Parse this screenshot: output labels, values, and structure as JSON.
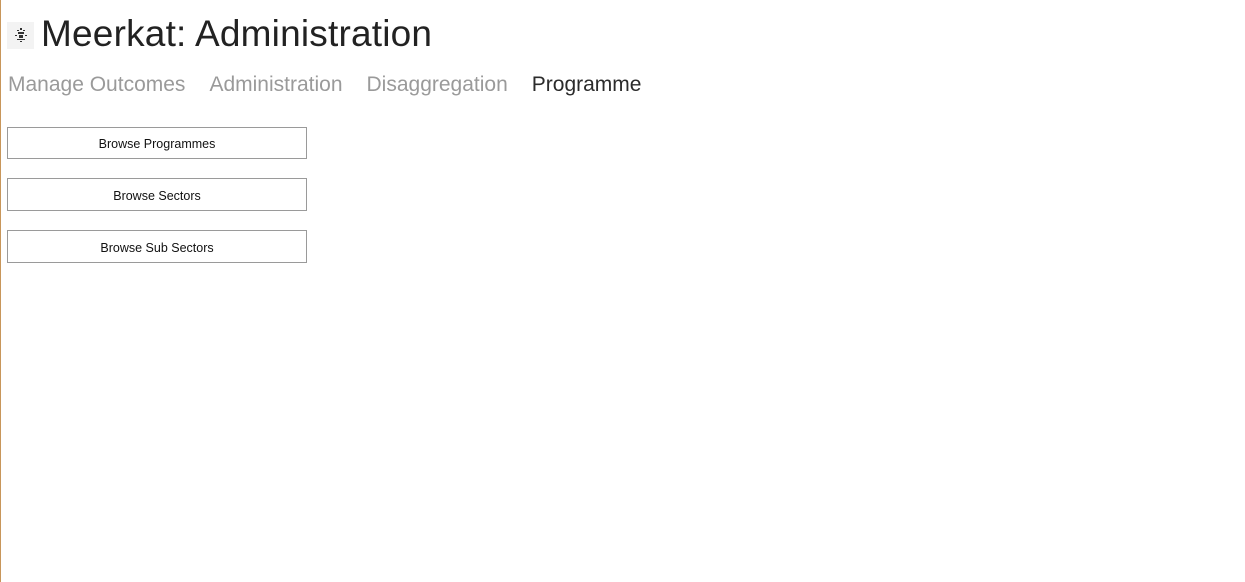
{
  "header": {
    "title": "Meerkat: Administration",
    "icon": "meerkat-logo-icon"
  },
  "tabs": [
    {
      "label": "Manage Outcomes",
      "active": false
    },
    {
      "label": "Administration",
      "active": false
    },
    {
      "label": "Disaggregation",
      "active": false
    },
    {
      "label": "Programme",
      "active": true
    }
  ],
  "actions": {
    "browse_programmes": "Browse Programmes",
    "browse_sectors": "Browse Sectors",
    "browse_sub_sectors": "Browse Sub Sectors"
  },
  "colors": {
    "active_tab": "#2b2b2b",
    "inactive_tab": "#9a9a9a",
    "window_border": "#c8965a"
  }
}
